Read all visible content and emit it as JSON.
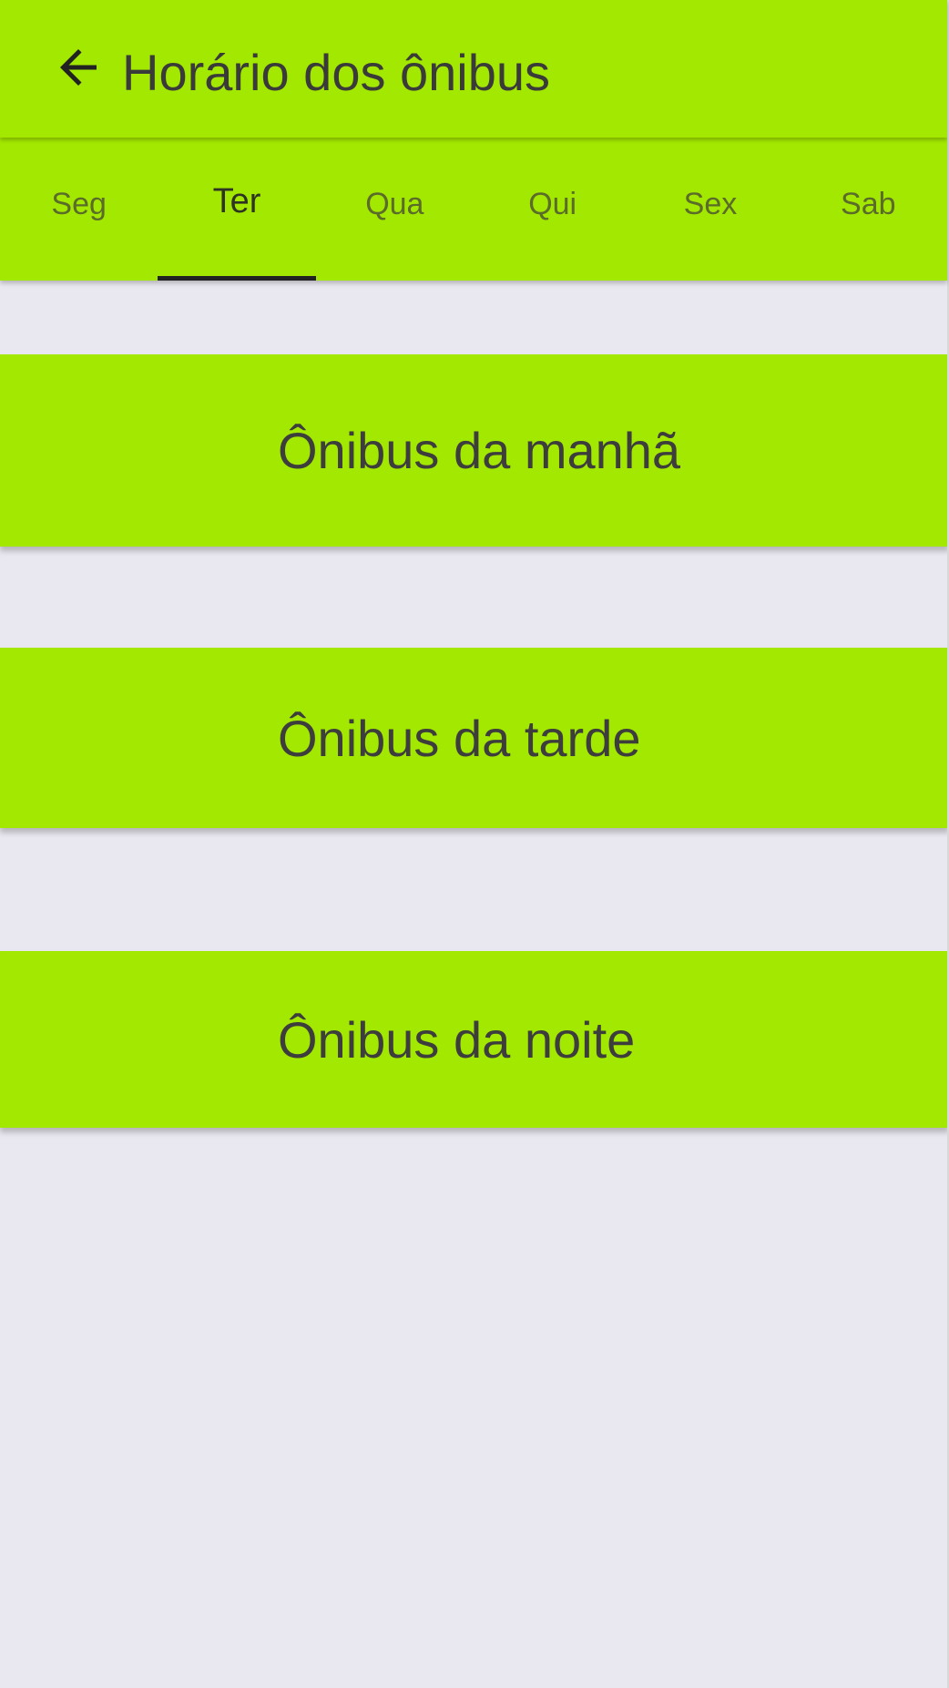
{
  "app_bar": {
    "back_icon": "arrow-left-icon",
    "title": "Horário dos ônibus"
  },
  "tabs": [
    {
      "label": "Seg",
      "active": false
    },
    {
      "label": "Ter",
      "active": true
    },
    {
      "label": "Qua",
      "active": false
    },
    {
      "label": "Qui",
      "active": false
    },
    {
      "label": "Sex",
      "active": false
    },
    {
      "label": "Sab",
      "active": false
    }
  ],
  "cards": [
    {
      "label": "Ônibus da manhã"
    },
    {
      "label": "Ônibus da tarde"
    },
    {
      "label": "Ônibus da noite"
    }
  ],
  "colors": {
    "accent": "#a3e800",
    "background": "#e9e7ef",
    "text": "#3a3a3a",
    "indicator": "#222222"
  }
}
